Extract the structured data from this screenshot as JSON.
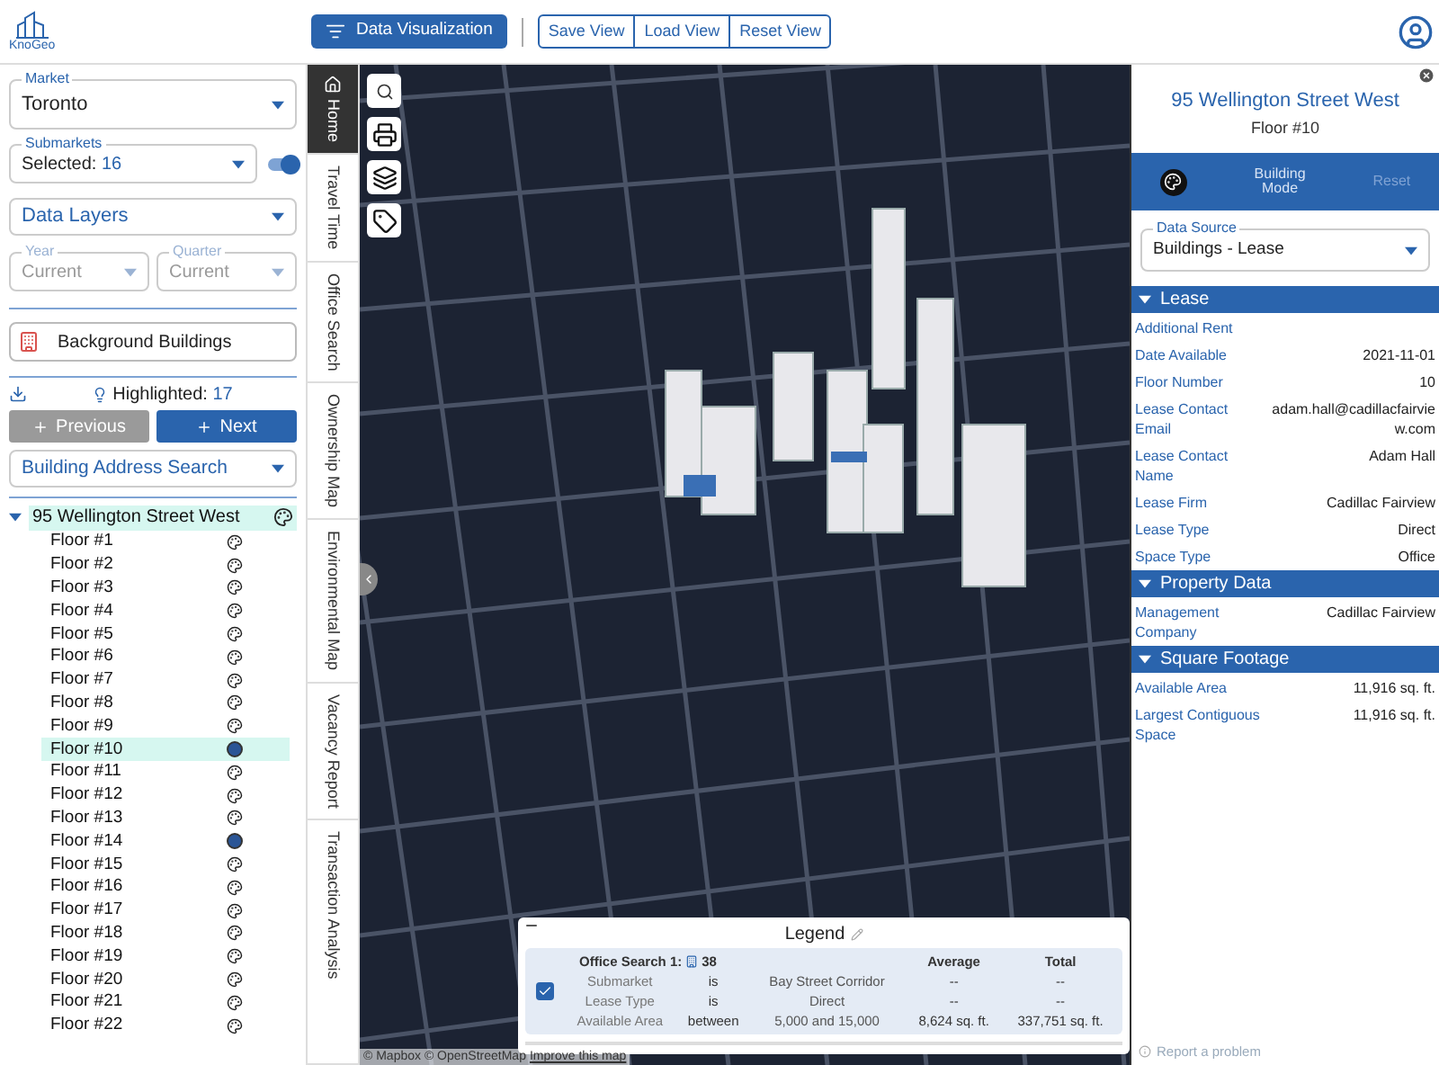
{
  "app": {
    "logo_text": "KnoGeo"
  },
  "toolbar": {
    "primary_button": "Data Visualization",
    "view_buttons": [
      "Save View",
      "Load View",
      "Reset View"
    ]
  },
  "filters": {
    "market": {
      "label": "Market",
      "value": "Toronto"
    },
    "submarkets": {
      "label": "Submarkets",
      "value_prefix": "Selected:",
      "count": "16",
      "toggle_on": true
    },
    "data_layers": {
      "placeholder": "Data Layers"
    },
    "year": {
      "label": "Year",
      "value": "Current",
      "disabled": true
    },
    "quarter": {
      "label": "Quarter",
      "value": "Current",
      "disabled": true
    },
    "background_buildings": "Background Buildings",
    "highlighted": {
      "label": "Highlighted:",
      "count": "17"
    },
    "previous_button": {
      "label": "Previous",
      "disabled": true
    },
    "next_button": {
      "label": "Next",
      "disabled": false
    },
    "address_search": {
      "placeholder": "Building Address Search"
    }
  },
  "tree": {
    "label": "95 Wellington Street West",
    "expanded": true,
    "children": [
      {
        "label": "Floor #1",
        "selected": false,
        "highlighted": false
      },
      {
        "label": "Floor #2",
        "selected": false,
        "highlighted": false
      },
      {
        "label": "Floor #3",
        "selected": false,
        "highlighted": false
      },
      {
        "label": "Floor #4",
        "selected": false,
        "highlighted": false
      },
      {
        "label": "Floor #5",
        "selected": false,
        "highlighted": false
      },
      {
        "label": "Floor #6",
        "selected": false,
        "highlighted": false
      },
      {
        "label": "Floor #7",
        "selected": false,
        "highlighted": false
      },
      {
        "label": "Floor #8",
        "selected": false,
        "highlighted": false
      },
      {
        "label": "Floor #9",
        "selected": false,
        "highlighted": false
      },
      {
        "label": "Floor #10",
        "selected": true,
        "highlighted": true
      },
      {
        "label": "Floor #11",
        "selected": false,
        "highlighted": false
      },
      {
        "label": "Floor #12",
        "selected": false,
        "highlighted": false
      },
      {
        "label": "Floor #13",
        "selected": false,
        "highlighted": false
      },
      {
        "label": "Floor #14",
        "selected": false,
        "highlighted": true
      },
      {
        "label": "Floor #15",
        "selected": false,
        "highlighted": false
      },
      {
        "label": "Floor #16",
        "selected": false,
        "highlighted": false
      },
      {
        "label": "Floor #17",
        "selected": false,
        "highlighted": false
      },
      {
        "label": "Floor #18",
        "selected": false,
        "highlighted": false
      },
      {
        "label": "Floor #19",
        "selected": false,
        "highlighted": false
      },
      {
        "label": "Floor #20",
        "selected": false,
        "highlighted": false
      },
      {
        "label": "Floor #21",
        "selected": false,
        "highlighted": false
      },
      {
        "label": "Floor #22",
        "selected": false,
        "highlighted": false
      }
    ]
  },
  "side_tabs": [
    {
      "label": "Home",
      "selected": true
    },
    {
      "label": "Travel Time",
      "selected": false
    },
    {
      "label": "Office Search",
      "selected": false
    },
    {
      "label": "Ownership Map",
      "selected": false
    },
    {
      "label": "Environmental Map",
      "selected": false
    },
    {
      "label": "Vacancy Report",
      "selected": false
    },
    {
      "label": "Transaction Analysis",
      "selected": false
    }
  ],
  "map": {
    "attribution": "© Mapbox © OpenStreetMap",
    "improve_link": "Improve this map"
  },
  "legend": {
    "title": "Legend",
    "search_name": "Office Search 1:",
    "count": "38",
    "columns": [
      "Average",
      "Total"
    ],
    "checked": true,
    "rows": [
      {
        "field": "Submarket",
        "operator": "is",
        "value": "Bay Street Corridor",
        "average": "--",
        "total": "--"
      },
      {
        "field": "Lease Type",
        "operator": "is",
        "value": "Direct",
        "average": "--",
        "total": "--"
      },
      {
        "field": "Available Area",
        "operator": "between",
        "value": "5,000 and 15,000",
        "average": "8,624 sq. ft.",
        "total": "337,751 sq. ft."
      }
    ]
  },
  "detail_panel": {
    "title": "95 Wellington Street West",
    "subtitle": "Floor #10",
    "mode_button": "Building Mode",
    "reset": {
      "label": "Reset",
      "disabled": true
    },
    "data_source": {
      "label": "Data Source",
      "value": "Buildings - Lease"
    },
    "sections": [
      {
        "title": "Lease",
        "expanded": true,
        "rows": [
          {
            "label": "Additional Rent"
          },
          {
            "label": "Date Available",
            "value": "2021-11-01"
          },
          {
            "label": "Floor Number",
            "value": "10"
          },
          {
            "label": "Lease Contact Email",
            "value": "adam.hall@cadillacfairview.com"
          },
          {
            "label": "Lease Contact Name",
            "value": "Adam Hall"
          },
          {
            "label": "Lease Firm",
            "value": "Cadillac Fairview"
          },
          {
            "label": "Lease Type",
            "value": "Direct"
          },
          {
            "label": "Space Type",
            "value": "Office"
          }
        ]
      },
      {
        "title": "Property Data",
        "expanded": true,
        "rows": [
          {
            "label": "Management Company",
            "value": "Cadillac Fairview"
          }
        ]
      },
      {
        "title": "Square Footage",
        "expanded": true,
        "rows": [
          {
            "label": "Available Area",
            "value": "11,916 sq. ft."
          },
          {
            "label": "Largest Contiguous Space",
            "value": "11,916 sq. ft."
          }
        ]
      }
    ],
    "report_link": "Report a problem"
  }
}
